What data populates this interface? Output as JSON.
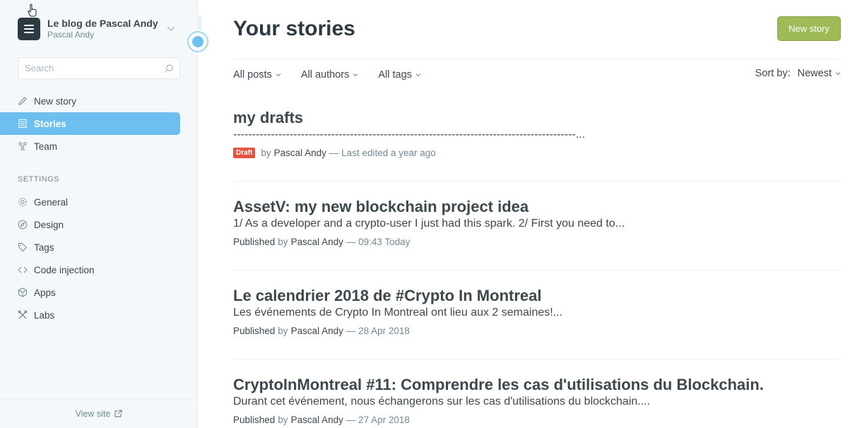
{
  "sidebar": {
    "blog_title": "Le blog de Pascal Andy",
    "blog_user": "Pascal Andy",
    "search_placeholder": "Search",
    "nav": [
      {
        "label": "New story",
        "icon": "pencil-icon"
      },
      {
        "label": "Stories",
        "icon": "document-icon",
        "active": true
      },
      {
        "label": "Team",
        "icon": "team-icon"
      }
    ],
    "settings_label": "SETTINGS",
    "settings": [
      {
        "label": "General",
        "icon": "gear-icon"
      },
      {
        "label": "Design",
        "icon": "compass-icon"
      },
      {
        "label": "Tags",
        "icon": "tag-icon"
      },
      {
        "label": "Code injection",
        "icon": "code-icon"
      },
      {
        "label": "Apps",
        "icon": "box-icon"
      },
      {
        "label": "Labs",
        "icon": "tools-icon"
      }
    ],
    "view_site": "View site"
  },
  "main": {
    "title": "Your stories",
    "new_story_button": "New story",
    "filters": [
      "All posts",
      "All authors",
      "All tags"
    ],
    "sort_label": "Sort by:",
    "sort_value": "Newest",
    "stories": [
      {
        "title": "my drafts",
        "excerpt": "-------------------------------------------------------------------------------------------...",
        "status": "Draft",
        "author": "Pascal Andy",
        "time": "Last edited a year ago"
      },
      {
        "title": "AssetV: my new blockchain project idea",
        "excerpt": "1/ As a developer and a crypto-user I just had this spark. 2/ First you need to...",
        "status": "Published",
        "author": "Pascal Andy",
        "time": "09:43 Today"
      },
      {
        "title": "Le calendrier 2018 de #Crypto In Montreal",
        "excerpt": "Les événements de Crypto In Montreal ont lieu aux 2 semaines!...",
        "status": "Published",
        "author": "Pascal Andy",
        "time": "28 Apr 2018"
      },
      {
        "title": "CryptoInMontreal #11: Comprendre les cas d'utilisations du Blockchain.",
        "excerpt": "Durant cet événement, nous échangerons sur les cas d'utilisations du blockchain....",
        "status": "Published",
        "author": "Pascal Andy",
        "time": "27 Apr 2018"
      }
    ]
  },
  "colors": {
    "accent": "#6cbfee",
    "primary_button": "#9fbb58",
    "draft_badge": "#e25440"
  }
}
